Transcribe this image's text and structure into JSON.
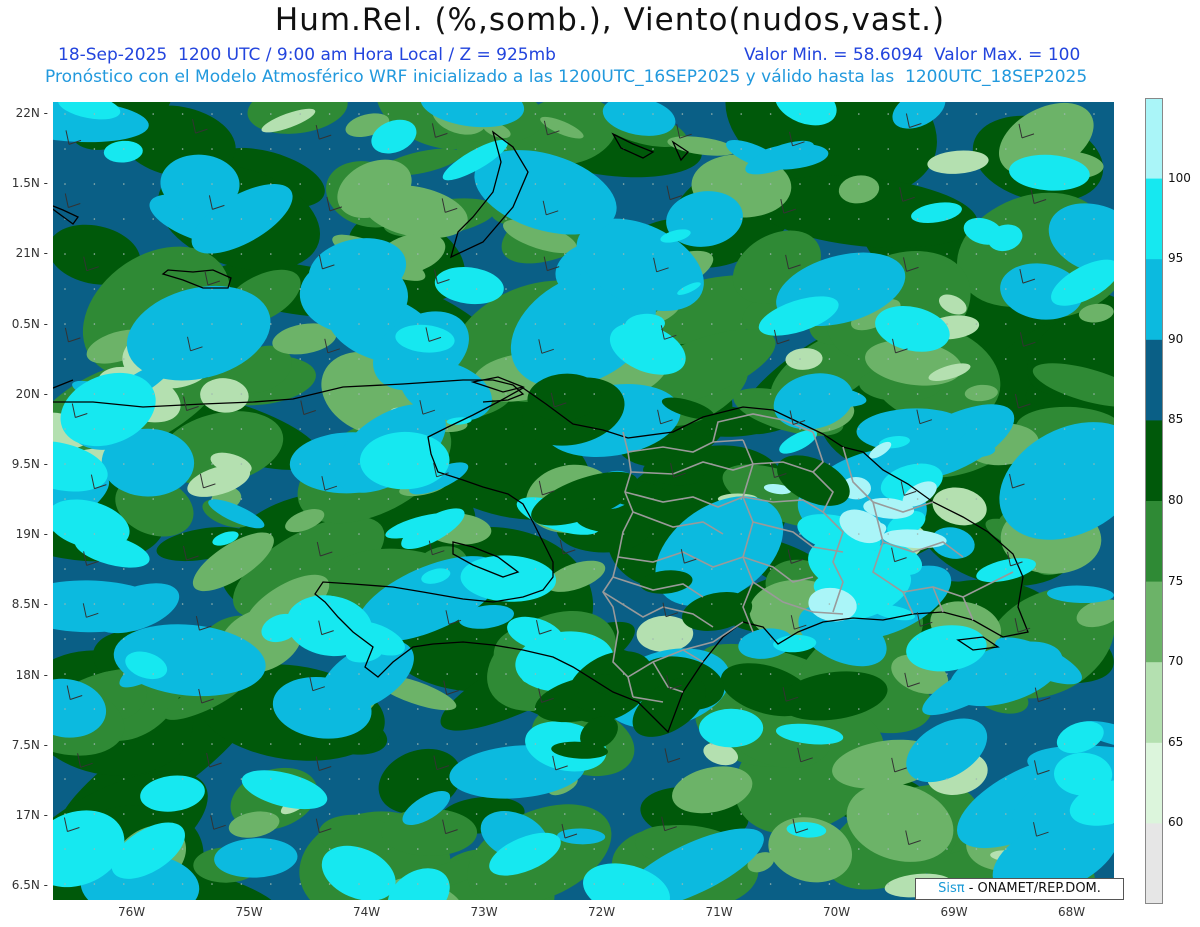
{
  "title": "Hum.Rel. (%,somb.), Viento(nudos,vast.)",
  "subtitle_line1_left": "18-Sep-2025  1200 UTC / 9:00 am Hora Local / Z = 925mb",
  "subtitle_line1_right": "Valor Min. = 58.6094  Valor Max. = 100",
  "subtitle_line2": "Pronóstico con el Modelo Atmosférico WRF inicializado a las 1200UTC_16SEP2025 y válido hasta las  1200UTC_18SEP2025",
  "lat_labels": [
    "22N",
    "1.5N",
    "21N",
    "0.5N",
    "20N",
    "9.5N",
    "19N",
    "8.5N",
    "18N",
    "7.5N",
    "17N",
    "6.5N"
  ],
  "lon_labels": [
    "76W",
    "75W",
    "74W",
    "73W",
    "72W",
    "71W",
    "70W",
    "69W",
    "68W"
  ],
  "colorbar": {
    "labels": [
      "100",
      "95",
      "90",
      "85",
      "80",
      "75",
      "70",
      "65",
      "60"
    ],
    "colors": [
      "#aaf5f8",
      "#16e8f0",
      "#0cbadf",
      "#0a5f86",
      "#00590a",
      "#2f8a35",
      "#6cb368",
      "#b4e0b0",
      "#dcf5dc",
      "#e6e6e6"
    ]
  },
  "credit": {
    "logo": "Sisπ",
    "text": "- ONAMET/REP.DOM."
  },
  "map_colors": {
    "sea_base": "#0a5f86",
    "rh80": "#00590a",
    "rh75": "#2f8a35",
    "rh70": "#6cb368",
    "rh65": "#b4e0b0",
    "rh90": "#0cbadf",
    "rh95": "#16e8f0",
    "rh100": "#aaf5f8",
    "coast": "#000000",
    "provinces": "#9a9a9a"
  }
}
